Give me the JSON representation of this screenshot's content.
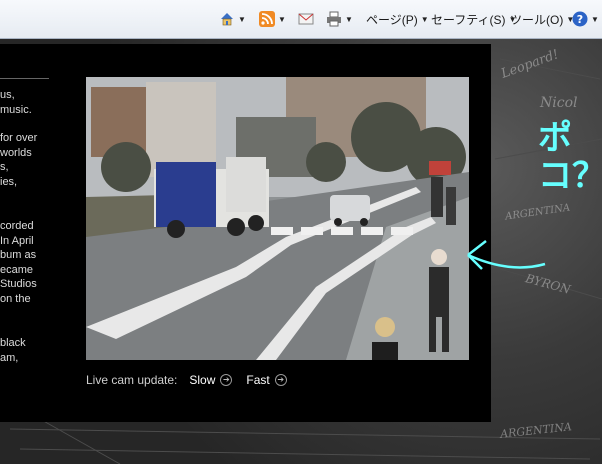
{
  "toolbar": {
    "page_label": "ページ(P)",
    "safety_label": "セーフティ(S)",
    "tools_label": "ツール(O)"
  },
  "left_text": {
    "lines": [
      "us,",
      "music.",
      "for over",
      "worlds",
      "s,",
      "ies,",
      "corded",
      "In April",
      "bum as",
      "ecame",
      "Studios",
      "on the",
      "black",
      "am,"
    ]
  },
  "caption": {
    "label": "Live cam update:",
    "slow": "Slow",
    "fast": "Fast"
  },
  "annotation": {
    "text": "ポコ？"
  },
  "wall": {
    "words": [
      "Nicol",
      "Leopard!",
      "ARGENTINA",
      "BYRON",
      "ARGENTINA"
    ]
  }
}
